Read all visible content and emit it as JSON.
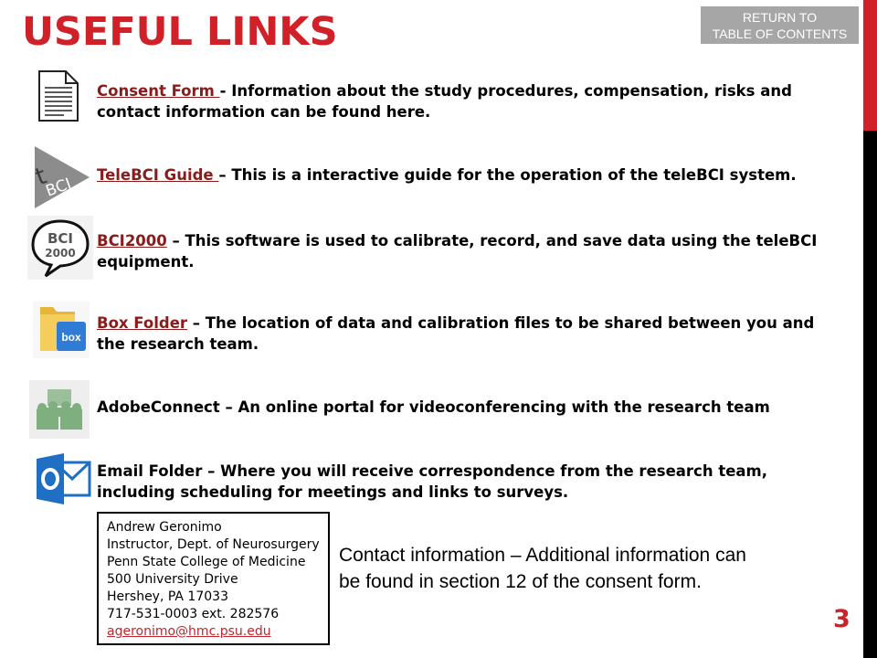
{
  "header": {
    "title": "USEFUL LINKS",
    "return_line1": "RETURN TO",
    "return_line2": "TABLE OF CONTENTS"
  },
  "colors": {
    "accent": "#d02028",
    "link": "#8b1a1a",
    "button_bg": "#a6a6a6"
  },
  "links": [
    {
      "link_text": "Consent Form ",
      "rest": "- Information about the study procedures, compensation, risks and contact information can be found here.",
      "icon": "document-icon"
    },
    {
      "link_text": "TeleBCI Guide ",
      "rest": "– This is a interactive guide for the operation of the teleBCI system.",
      "icon": "telebci-logo-icon"
    },
    {
      "link_text": "BCI2000",
      "rest": " – This software is used to calibrate, record, and save data using the teleBCI equipment.",
      "icon": "bci2000-logo-icon"
    },
    {
      "link_text": "Box Folder",
      "rest": " – The location of data and calibration files to be shared between you and the research team.",
      "icon": "box-folder-icon"
    },
    {
      "link_text": "",
      "rest": "AdobeConnect – An online portal for videoconferencing with the research team",
      "icon": "adobeconnect-icon"
    },
    {
      "link_text": "",
      "rest": "Email Folder – Where you will receive correspondence from the research team, including scheduling for meetings and links to surveys.",
      "icon": "outlook-icon"
    }
  ],
  "contact": {
    "name": "Andrew Geronimo",
    "position": "Instructor, Dept. of Neurosurgery",
    "institution": "Penn State College of Medicine",
    "street": "500 University Drive",
    "city": "Hershey, PA 17033",
    "phone": "717-531-0003 ext. 282576",
    "email": "ageronimo@hmc.psu.edu"
  },
  "contact_note": "Contact information – Additional information can be found in section 12 of the consent form.",
  "page_number": "3"
}
